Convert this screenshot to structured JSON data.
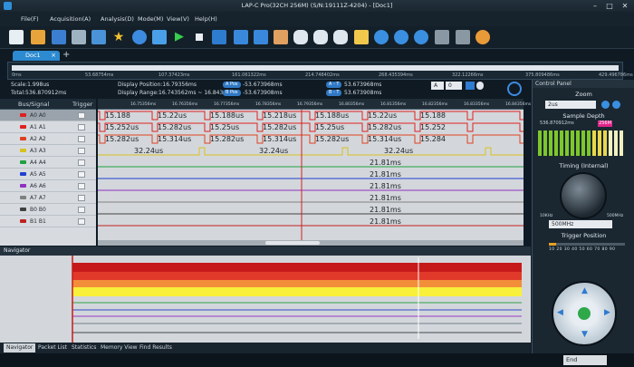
{
  "window": {
    "title": "LAP-C Pro(32CH 256M) (S/N:19111Z-4204) - [Doc1]",
    "controls": [
      "–",
      "□",
      "✕"
    ]
  },
  "menu": [
    {
      "label": "File(F)"
    },
    {
      "label": "Acquisition(A)"
    },
    {
      "label": "Analysis(D)"
    },
    {
      "label": "Mode(M)"
    },
    {
      "label": "View(V)"
    },
    {
      "label": "Help(H)"
    }
  ],
  "toolbar": {
    "icons": [
      "new-file-icon",
      "open-folder-icon",
      "save-icon",
      "print-icon",
      "copy-icon",
      "star-icon",
      "settings-icon",
      "tools-icon",
      "run-icon",
      "stop-icon",
      "cursor-icon",
      "flag-icon",
      "flag-icon",
      "flag-icon",
      "pen-icon",
      "bubble-icon",
      "bubble-icon",
      "bubble-icon",
      "grid-icon",
      "zoom-in-icon",
      "zoom-out-icon",
      "zoom-fit-icon",
      "hand-icon",
      "link-icon",
      "target-icon"
    ]
  },
  "tabs": {
    "doc_label": "Doc1",
    "close": "×",
    "add": "+"
  },
  "overview_ticks": [
    "0ms",
    "53.68754ms",
    "107.37423ms",
    "161.061322ms",
    "214.748402ms",
    "268.435394ms",
    "322.12266ms",
    "375.809486ms",
    "429.496786ms"
  ],
  "info": {
    "scale": "Scale:1.998us",
    "total": "Total:536.870912ms",
    "display_position": "Display Position:16.79356ms",
    "display_range": "Display Range:16.743562ms ~ 16.843...",
    "a_pos_label": "A Pos",
    "a_pos_value": "-53.673968ms",
    "b_pos_label": "B Pos",
    "b_pos_value": "-53.673908ms",
    "at_label": "A - T",
    "at_value": "53.673968ms",
    "bt_label": "B - T",
    "bt_value": "53.673908ms",
    "cursor_sel": "A",
    "cursor_num": "0"
  },
  "signal_panel": {
    "header_bus": "Bus/Signal",
    "header_trigger": "Trigger",
    "rows": [
      {
        "name": "A0  A0",
        "color": "#e02020",
        "selected": true
      },
      {
        "name": "A1  A1",
        "color": "#e02020",
        "selected": false
      },
      {
        "name": "A2  A2",
        "color": "#e04020",
        "selected": false
      },
      {
        "name": "A3  A3",
        "color": "#d8c020",
        "selected": false
      },
      {
        "name": "A4  A4",
        "color": "#20a040",
        "selected": false
      },
      {
        "name": "A5  A5",
        "color": "#2040d0",
        "selected": false
      },
      {
        "name": "A6  A6",
        "color": "#9030c0",
        "selected": false
      },
      {
        "name": "A7  A7",
        "color": "#808080",
        "selected": false
      },
      {
        "name": "B0  B0",
        "color": "#404040",
        "selected": false
      },
      {
        "name": "B1  B1",
        "color": "#c02020",
        "selected": false
      }
    ]
  },
  "wave_ruler": [
    "16.75356ms",
    "16.76356ms",
    "16.77356ms",
    "16.78356ms",
    "16.79356ms",
    "16.80356ms",
    "16.81356ms",
    "16.82356ms",
    "16.83356ms",
    "16.84356ms"
  ],
  "wave_rows": [
    {
      "labels": [
        "15.188",
        "15.22us",
        "15.188us",
        "15.218us",
        "15.188us",
        "15.22us",
        "15.188"
      ]
    },
    {
      "labels": [
        "15.252us",
        "15.282us",
        "15.25us",
        "15.282us",
        "15.25us",
        "15.282us",
        "15.252"
      ]
    },
    {
      "labels": [
        "15.282us",
        "15.314us",
        "15.282us",
        "15.314us",
        "15.282us",
        "15.314us",
        "15.284"
      ]
    },
    {
      "labels": [
        "32.24us",
        "32.24us",
        "32.24us"
      ]
    },
    {
      "labels": [
        "21.81ms"
      ]
    },
    {
      "labels": [
        "21.81ms"
      ]
    },
    {
      "labels": [
        "21.81ms"
      ]
    },
    {
      "labels": [
        "21.81ms"
      ]
    },
    {
      "labels": [
        "21.81ms"
      ]
    },
    {
      "labels": [
        "21.81ms"
      ]
    }
  ],
  "navigator": {
    "title": "Navigator",
    "tabs": [
      "Navigator",
      "Packet List",
      "Statistics",
      "Memory View",
      "Find Results"
    ]
  },
  "control_panel": {
    "title": "Control Panel",
    "zoom_title": "Zoom",
    "zoom_value": "2us",
    "sample_depth_title": "Sample Depth",
    "sample_depth_value": "536.870912ms",
    "sample_depth_badge": "256M",
    "timing_title": "Timing (Internal)",
    "timing_min": "10KHz",
    "timing_max": "500MHz",
    "timing_value": "500MHz",
    "trigger_position_title": "Trigger Position",
    "trigger_scale": "10 20 30 40 50 60 70 80 90",
    "trigger_position": 0.1
  },
  "status": {
    "end_label": "End"
  }
}
